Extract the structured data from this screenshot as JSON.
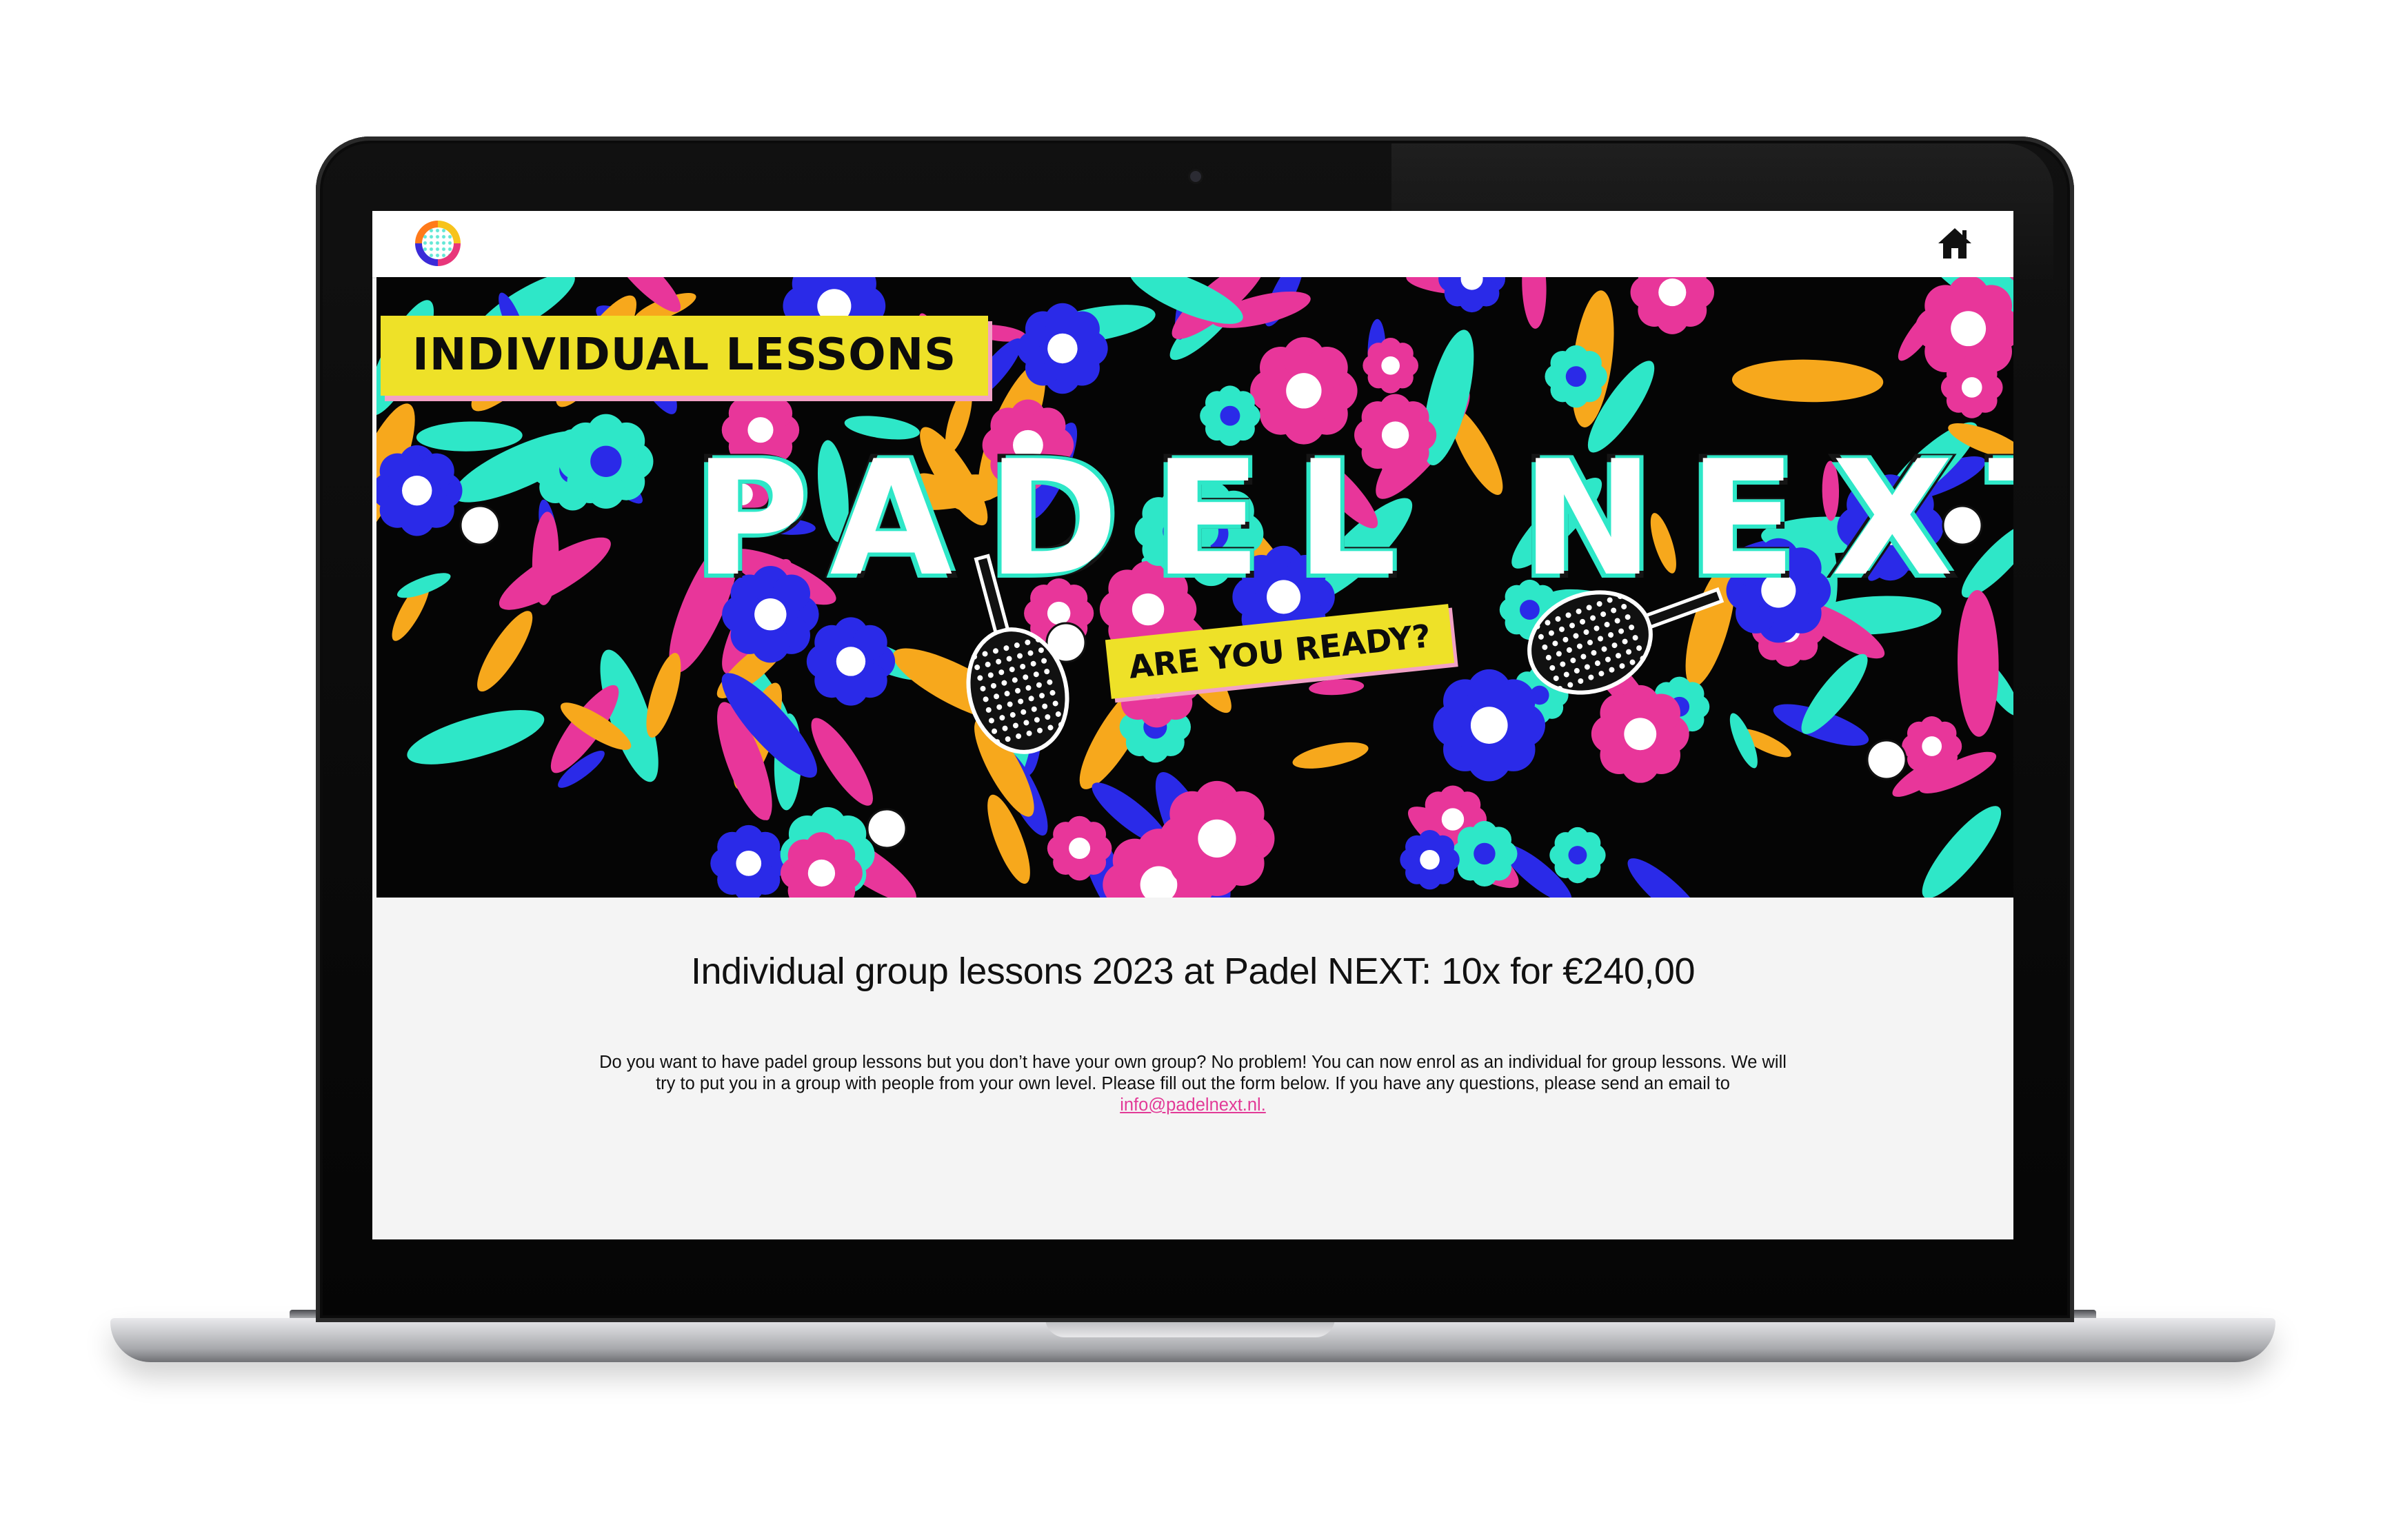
{
  "nav": {
    "logo_icon": "padel-next-logo",
    "home_icon": "home-icon"
  },
  "hero": {
    "tag": "INDIVIDUAL LESSONS",
    "title": "PADEL NEXT",
    "subtitle": "ARE YOU READY?",
    "colors": {
      "background": "#050505",
      "tag_yellow": "#eee128",
      "pink": "#e8369a",
      "blue": "#2a2ae8",
      "turquoise": "#2ee7c8",
      "orange": "#f7a81c"
    }
  },
  "content": {
    "headline": "Individual group lessons 2023 at Padel NEXT: 10x for €240,00",
    "intro_text": "Do you want to have padel group lessons but you don’t have your own group? No problem! You can now enrol as an individual for group lessons. We will try to put you in a group with people from your own level. Please fill out the form below. If you have any questions, please send an email to",
    "email_link": "info@padelnext.nl."
  }
}
